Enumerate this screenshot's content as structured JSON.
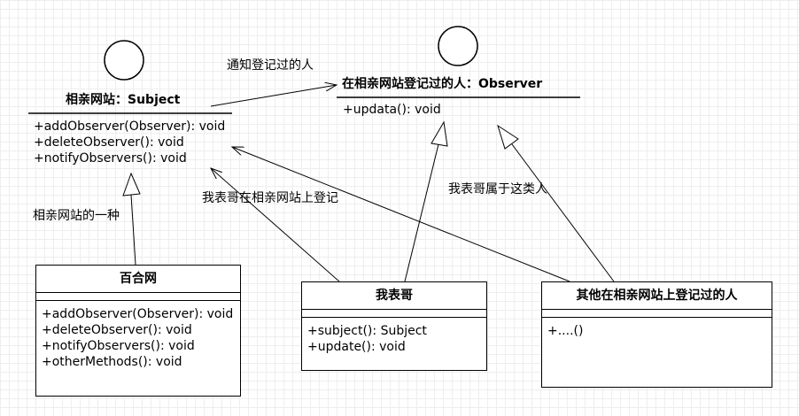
{
  "subject": {
    "title": "相亲网站：Subject",
    "methods": [
      "+addObserver(Observer): void",
      "+deleteObserver(): void",
      "+notifyObservers(): void"
    ]
  },
  "observer": {
    "title": "在相亲网站登记过的人：Observer",
    "methods": [
      "+updata(): void"
    ]
  },
  "baihe": {
    "title": "百合网",
    "methods": [
      "+addObserver(Observer): void",
      "+deleteObserver(): void",
      "+notifyObservers(): void",
      "+otherMethods(): void"
    ]
  },
  "cousin": {
    "title": "我表哥",
    "methods": [
      "+subject(): Subject",
      "+update(): void"
    ]
  },
  "others": {
    "title": "其他在相亲网站上登记过的人",
    "methods": [
      "+....()"
    ]
  },
  "labels": {
    "notify": "通知登记过的人",
    "kind_of": "相亲网站的一种",
    "registered": "我表哥在相亲网站上登记",
    "belongs": "我表哥属于这类人"
  }
}
